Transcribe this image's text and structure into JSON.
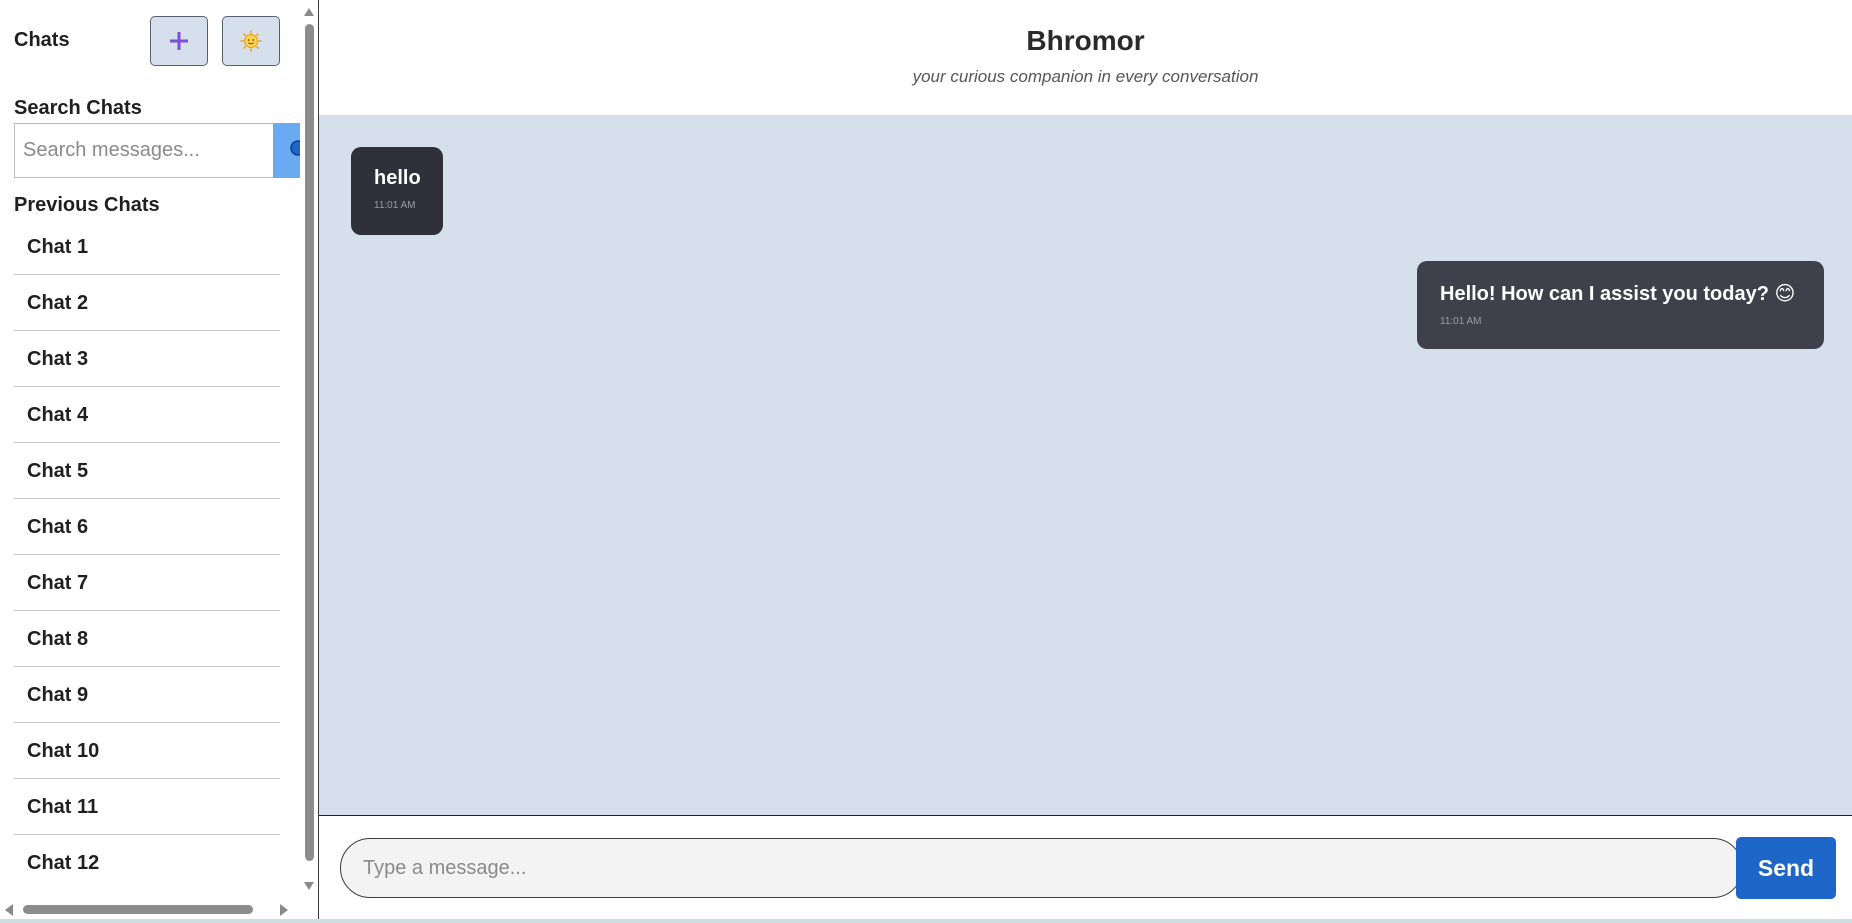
{
  "sidebar": {
    "title": "Chats",
    "new_chat_icon": "plus-icon",
    "theme_icon": "sun-face-icon",
    "search_label": "Search Chats",
    "search_placeholder": "Search messages...",
    "search_icon": "search-icon",
    "previous_label": "Previous Chats",
    "chats": [
      {
        "label": "Chat 1"
      },
      {
        "label": "Chat 2"
      },
      {
        "label": "Chat 3"
      },
      {
        "label": "Chat 4"
      },
      {
        "label": "Chat 5"
      },
      {
        "label": "Chat 6"
      },
      {
        "label": "Chat 7"
      },
      {
        "label": "Chat 8"
      },
      {
        "label": "Chat 9"
      },
      {
        "label": "Chat 10"
      },
      {
        "label": "Chat 11"
      },
      {
        "label": "Chat 12"
      }
    ]
  },
  "header": {
    "title": "Bhromor",
    "subtitle": "your curious companion in every conversation"
  },
  "messages": [
    {
      "role": "user",
      "text": "hello",
      "time": "11:01 AM"
    },
    {
      "role": "assistant",
      "text": "Hello! How can I assist you today? 😊",
      "time": "11:01 AM"
    }
  ],
  "composer": {
    "placeholder": "Type a message...",
    "send_label": "Send"
  },
  "colors": {
    "accent": "#1d66c8",
    "chat_background": "#d5e0ec",
    "bubble": "#34353f",
    "icon_button": "#d6e0ec",
    "new_chat_icon": "#7b4fd6"
  }
}
